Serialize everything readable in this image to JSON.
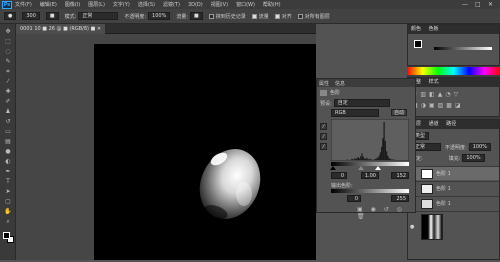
{
  "app": {
    "logo": "Ps"
  },
  "menu": [
    "文件(F)",
    "编辑(E)",
    "图像(I)",
    "图层(L)",
    "文字(Y)",
    "选择(S)",
    "滤镜(T)",
    "3D(D)",
    "视图(V)",
    "窗口(W)",
    "帮助(H)"
  ],
  "window_controls": {
    "min": "—",
    "max": "□",
    "close": "✕"
  },
  "options": {
    "tool_preset": "●",
    "brush_size": "300",
    "brush_btn": "■",
    "mode_label": "模式:",
    "mode_value": "正常",
    "opacity_label": "不透明度:",
    "opacity_value": "100%",
    "flow_label": "流量:",
    "flow_value": "■",
    "erase_history_label": "抹到历史记录",
    "erase_history_on": false,
    "flow_pct_label": "流量",
    "flow_pct_on": true,
    "align_label": "对齐",
    "align_on": true,
    "sample_label": "对所有图层",
    "sample_on": false
  },
  "document": {
    "tab_label": "0001 10 ■ 26 @ ■ (RGB/8) ■ ✕"
  },
  "colors": {
    "foreground": "#000000",
    "background": "#ffffff",
    "accent": "#31a8ff"
  },
  "tools": [
    "move-icon",
    "marquee-icon",
    "lasso-icon",
    "quick-select-icon",
    "crop-icon",
    "eyedropper-icon",
    "healing-icon",
    "brush-icon",
    "clone-stamp-icon",
    "history-brush-icon",
    "eraser-icon",
    "gradient-icon",
    "blur-icon",
    "dodge-icon",
    "pen-icon",
    "type-icon",
    "path-select-icon",
    "shape-icon",
    "hand-icon",
    "zoom-icon"
  ],
  "color_panel": {
    "tab1": "颜色",
    "tab2": "色板"
  },
  "adjust_panel": {
    "tab1": "调整",
    "tab2": "样式"
  },
  "properties": {
    "tabs": [
      "属性",
      "信息"
    ],
    "title": "色阶",
    "preset_label": "预设:",
    "preset_value": "自定",
    "channel_value": "RGB",
    "auto_button": "自动",
    "input_black": "0",
    "input_gamma": "1.00",
    "input_white": "152",
    "output_label": "输出色阶:",
    "output_black": "0",
    "output_white": "255"
  },
  "layers_panel": {
    "tabs": [
      "图层",
      "通道",
      "路径"
    ],
    "kind_label": "类型",
    "blend_value": "正常",
    "opacity_label": "不透明度:",
    "opacity_value": "100%",
    "lock_label": "锁定:",
    "fill_label": "填充:",
    "fill_value": "100%",
    "layers": [
      {
        "name": "色阶 1",
        "visible": true
      },
      {
        "name": "色阶 1",
        "visible": true
      },
      {
        "name": "色阶 1",
        "visible": true
      },
      {
        "name": "",
        "visible": true
      }
    ]
  },
  "histogram_levels": [
    0,
    0,
    0,
    0,
    0,
    0,
    0,
    0,
    0,
    0,
    0,
    0,
    1,
    0,
    0,
    1,
    2,
    1,
    3,
    2,
    4,
    5,
    3,
    7,
    12,
    6,
    3,
    2,
    4,
    1,
    2,
    1,
    1,
    0,
    1,
    2,
    3,
    5,
    8,
    14,
    24,
    40,
    70,
    35,
    16,
    8,
    4,
    2,
    1,
    1,
    1,
    0,
    0,
    0,
    0,
    0,
    0,
    0,
    0,
    0,
    0,
    0
  ]
}
